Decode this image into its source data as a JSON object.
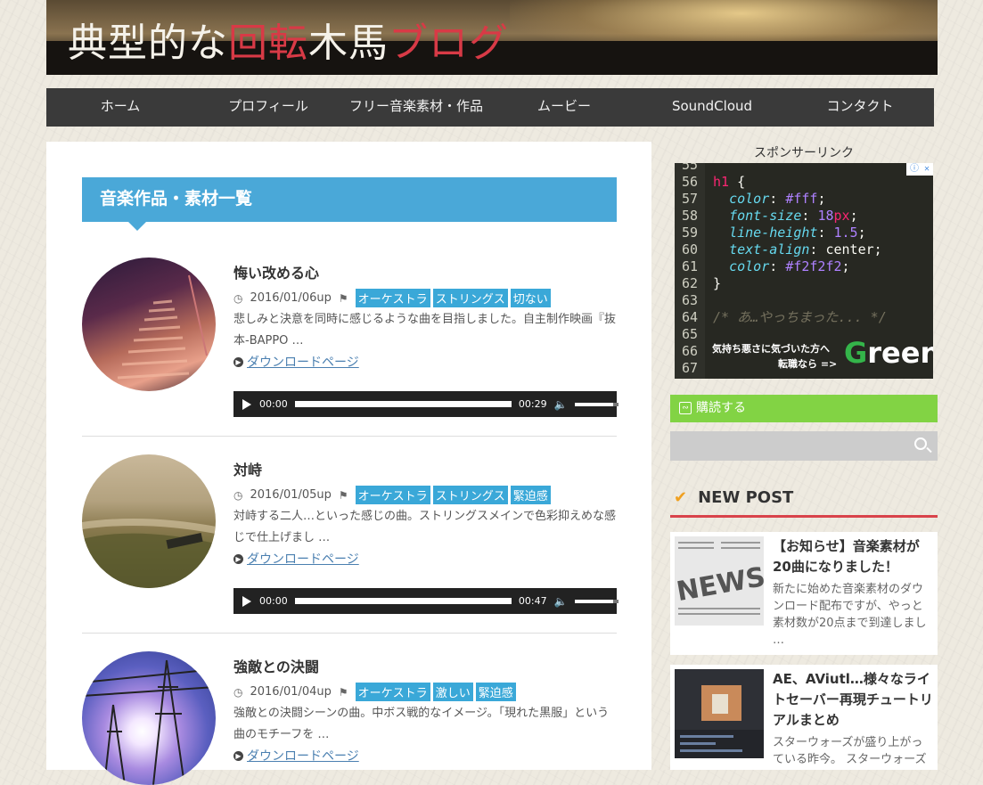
{
  "header": {
    "title_parts": [
      {
        "text": "典型的な",
        "style": "white"
      },
      {
        "text": "回転",
        "style": "red"
      },
      {
        "text": "木馬",
        "style": "white"
      },
      {
        "text": "ブログ",
        "style": "red"
      }
    ]
  },
  "nav": [
    "ホーム",
    "プロフィール",
    "フリー音楽素材・作品",
    "ムービー",
    "SoundCloud",
    "コンタクト"
  ],
  "main": {
    "section_title": "音楽作品・素材一覧",
    "posts": [
      {
        "title": "悔い改める心",
        "date": "2016/01/06up",
        "tags": [
          "オーケストラ",
          "ストリングス",
          "切ない"
        ],
        "excerpt": "悲しみと決意を同時に感じるような曲を目指しました。自主制作映画『抜本-BAPPO …",
        "download": "ダウンロードページ",
        "player": {
          "current": "00:00",
          "duration": "00:29"
        }
      },
      {
        "title": "対峙",
        "date": "2016/01/05up",
        "tags": [
          "オーケストラ",
          "ストリングス",
          "緊迫感"
        ],
        "excerpt": "対峙する二人…といった感じの曲。ストリングスメインで色彩抑えめな感じで仕上げまし …",
        "download": "ダウンロードページ",
        "player": {
          "current": "00:00",
          "duration": "00:47"
        }
      },
      {
        "title": "強敵との決闘",
        "date": "2016/01/04up",
        "tags": [
          "オーケストラ",
          "激しい",
          "緊迫感"
        ],
        "excerpt": "強敵との決闘シーンの曲。中ボス戦的なイメージ。「現れた黒服」という曲のモチーフを …",
        "download": "ダウンロードページ"
      }
    ]
  },
  "sidebar": {
    "sponsor_label": "スポンサーリンク",
    "ad": {
      "code_lines": [
        {
          "n": "55",
          "parts": []
        },
        {
          "n": "56",
          "parts": [
            {
              "c": "sel",
              "t": "h1"
            },
            {
              "c": "wht",
              "t": " {"
            }
          ]
        },
        {
          "n": "57",
          "parts": [
            {
              "c": "prop",
              "t": "  color"
            },
            {
              "c": "wht",
              "t": ": "
            },
            {
              "c": "val",
              "t": "#fff"
            },
            {
              "c": "wht",
              "t": ";"
            }
          ]
        },
        {
          "n": "58",
          "parts": [
            {
              "c": "prop",
              "t": "  font-size"
            },
            {
              "c": "wht",
              "t": ": "
            },
            {
              "c": "val",
              "t": "18"
            },
            {
              "c": "sel",
              "t": "px"
            },
            {
              "c": "wht",
              "t": ";"
            }
          ]
        },
        {
          "n": "59",
          "parts": [
            {
              "c": "prop",
              "t": "  line-height"
            },
            {
              "c": "wht",
              "t": ": "
            },
            {
              "c": "val",
              "t": "1.5"
            },
            {
              "c": "wht",
              "t": ";"
            }
          ]
        },
        {
          "n": "60",
          "parts": [
            {
              "c": "prop",
              "t": "  text-align"
            },
            {
              "c": "wht",
              "t": ": center;"
            }
          ]
        },
        {
          "n": "61",
          "parts": [
            {
              "c": "prop",
              "t": "  color"
            },
            {
              "c": "wht",
              "t": ": "
            },
            {
              "c": "val",
              "t": "#f2f2f2"
            },
            {
              "c": "wht",
              "t": ";"
            }
          ]
        },
        {
          "n": "62",
          "parts": [
            {
              "c": "wht",
              "t": "}"
            }
          ]
        },
        {
          "n": "63",
          "parts": []
        },
        {
          "n": "64",
          "parts": [
            {
              "c": "cmt",
              "t": "/* あ…やっちまった... */"
            }
          ]
        },
        {
          "n": "65",
          "parts": []
        },
        {
          "n": "66",
          "parts": []
        },
        {
          "n": "67",
          "parts": []
        }
      ],
      "ad_text_1": "気持ち悪さに気づいた方へ",
      "ad_text_2": "転職なら =>",
      "logo_g": "G",
      "logo_rest": "reen",
      "close_label": "ⓘ ✕"
    },
    "rss_label": "購読する",
    "search_placeholder": "",
    "new_post_title": "NEW POST",
    "new_posts": [
      {
        "title": "【お知らせ】音楽素材が20曲になりました！",
        "desc": "新たに始めた音楽素材のダウンロード配布ですが、やっと素材数が20点まで到達しまし …"
      },
      {
        "title": "AE、AViutl…様々なライトセーバー再現チュートリアルまとめ",
        "desc": "スターウォーズが盛り上がっている昨今。 スターウォーズ"
      }
    ]
  }
}
